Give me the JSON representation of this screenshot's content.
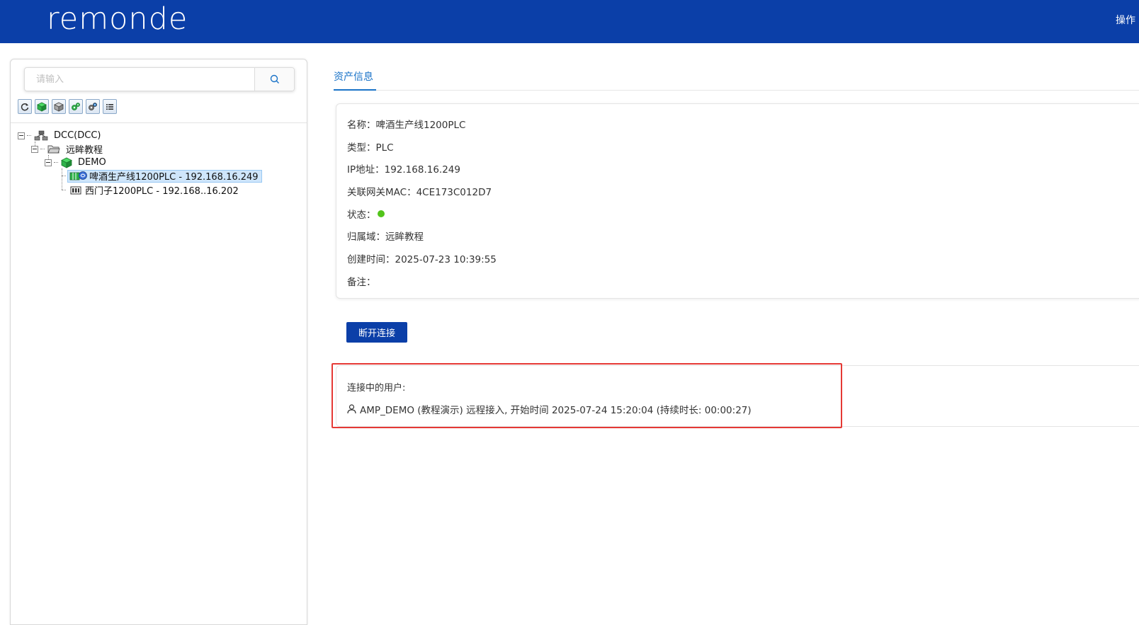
{
  "header": {
    "logo": "remonde",
    "right_text": "操作"
  },
  "sidebar": {
    "search_placeholder": "请输入",
    "toolbar_icons": [
      "refresh-icon",
      "cube-green-icon",
      "cube-gray-icon",
      "gears-green-icon",
      "gears-gray-icon",
      "list-icon"
    ],
    "tree": {
      "root": "DCC(DCC)",
      "group": "远眸教程",
      "subgroup": "DEMO",
      "devices": [
        "啤酒生产线1200PLC - 192.168.16.249",
        "西门子1200PLC - 192.168..16.202"
      ]
    }
  },
  "main": {
    "tab_label": "资产信息",
    "info": {
      "name": "名称：啤酒生产线1200PLC",
      "type": "类型：PLC",
      "ip": "IP地址：192.168.16.249",
      "mac": "关联网关MAC：4CE173C012D7",
      "status_label": "状态：",
      "status_color": "#52c41a",
      "domain": "归属域：远眸教程",
      "created": "创建时间：2025-07-23 10:39:55",
      "remark": "备注："
    },
    "disconnect_label": "断开连接",
    "users": {
      "title": "连接中的用户:",
      "entry": "AMP_DEMO (教程演示) 远程接入, 开始时间 2025-07-24 15:20:04 (持续时长: 00:00:27)"
    }
  },
  "colors": {
    "brand": "#0b3fa8",
    "accent": "#1a73c8",
    "highlight": "#e53935"
  }
}
